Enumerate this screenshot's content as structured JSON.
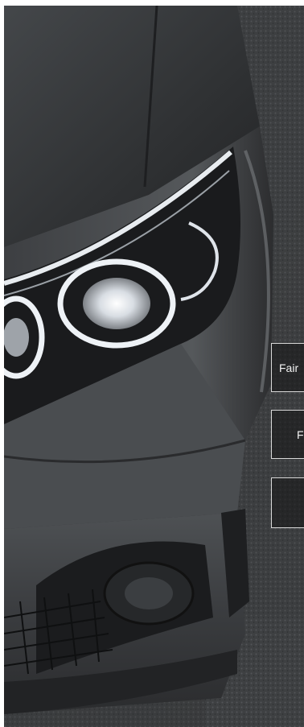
{
  "hero": {
    "subject": "car-headlight-photo",
    "palette": {
      "body": "#3b3d40",
      "shadow": "#1c1d1f",
      "highlight": "#8a8c8f",
      "lamp": "#e9edf2",
      "ground": "#4a4c4e"
    }
  },
  "side_menu": {
    "items": [
      {
        "label": "Fair"
      },
      {
        "label": "F"
      },
      {
        "label": ""
      }
    ]
  }
}
